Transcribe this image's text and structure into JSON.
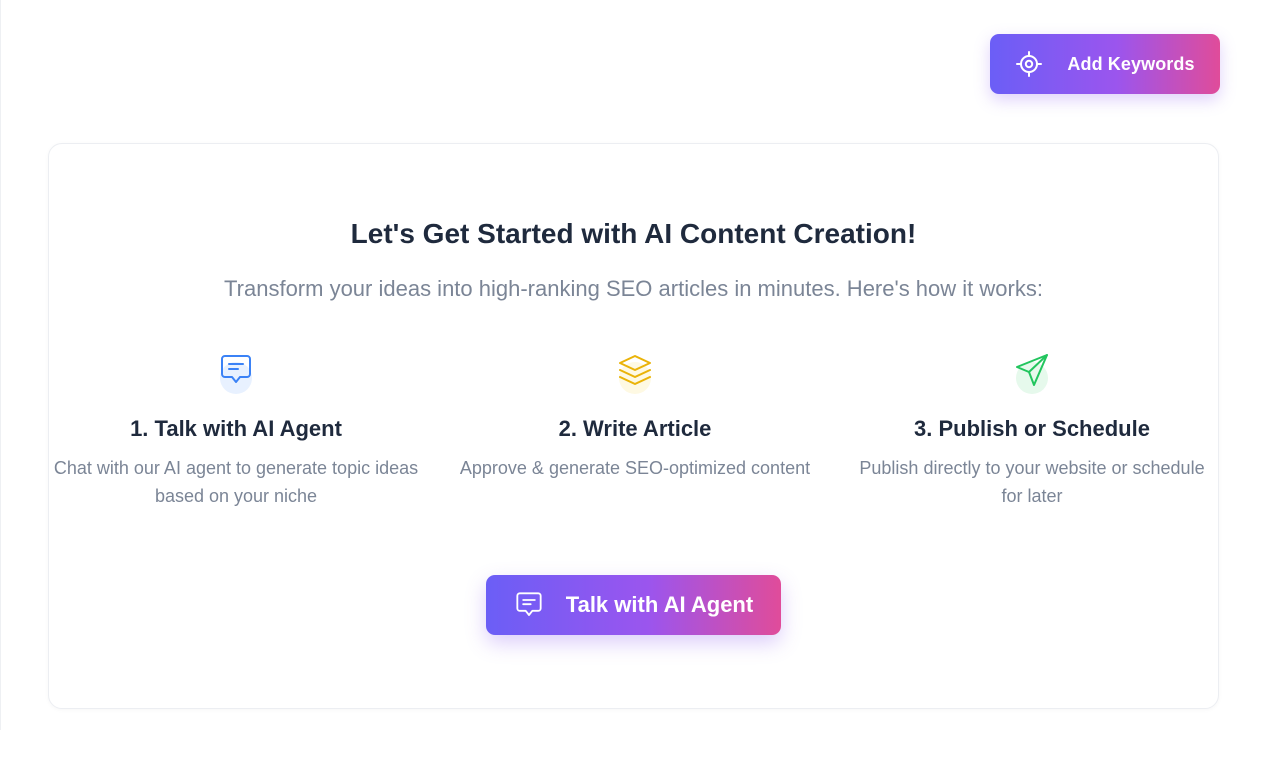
{
  "header": {
    "add_keywords_label": "Add Keywords",
    "add_keywords_icon": "target-icon"
  },
  "onboarding": {
    "title": "Let's Get Started with AI Content Creation!",
    "subtitle": "Transform your ideas into high-ranking SEO articles in minutes. Here's how it works:",
    "steps": [
      {
        "icon": "chat-bubble-icon",
        "icon_color": "#3b82f6",
        "title": "1. Talk with AI Agent",
        "description": "Chat with our AI agent to generate topic ideas based on your niche"
      },
      {
        "icon": "layers-icon",
        "icon_color": "#eab308",
        "title": "2. Write Article",
        "description": "Approve & generate SEO-optimized content"
      },
      {
        "icon": "send-icon",
        "icon_color": "#22c55e",
        "title": "3. Publish or Schedule",
        "description": "Publish directly to your website or schedule for later"
      }
    ],
    "cta_label": "Talk with AI Agent",
    "cta_icon": "chat-bubble-icon"
  },
  "colors": {
    "gradient_start": "#6b5ef6",
    "gradient_mid": "#9b55ee",
    "gradient_end": "#e04c9a",
    "heading": "#1f2a3d",
    "muted_text": "#7b8596"
  }
}
